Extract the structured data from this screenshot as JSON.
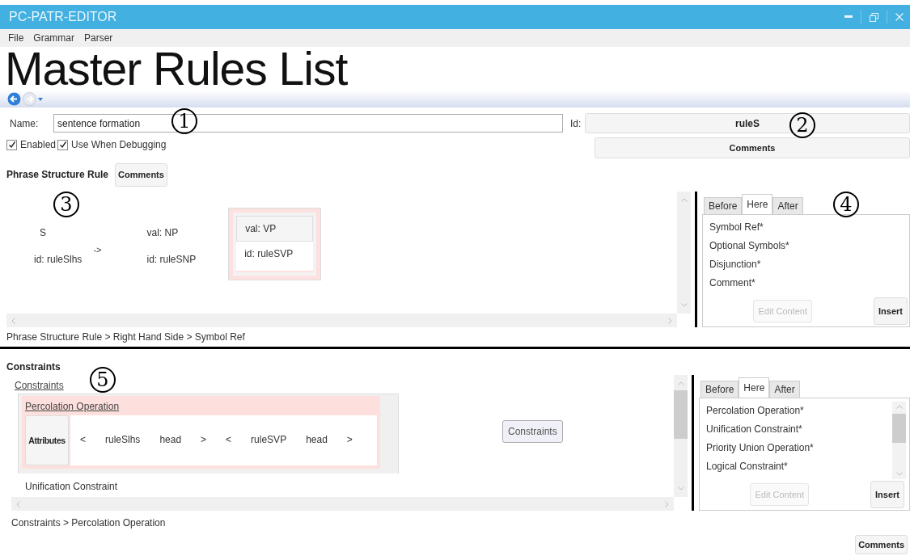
{
  "window": {
    "title": "PC-PATR-EDITOR"
  },
  "menu": [
    "File",
    "Grammar",
    "Parser"
  ],
  "page_title": "Master Rules List",
  "rule": {
    "name_label": "Name:",
    "name": "sentence formation",
    "id_label": "Id:",
    "id": "ruleS",
    "comments_button": "Comments",
    "options": [
      {
        "label": "Enabled",
        "checked": true
      },
      {
        "label": "Use When Debugging",
        "checked": true
      }
    ]
  },
  "phrase_structure": {
    "heading": "Phrase Structure Rule",
    "comments_button": "Comments",
    "lhs": {
      "value": "S",
      "id": "id: ruleSlhs"
    },
    "arrow": "->",
    "rhs": [
      {
        "value": "val: NP",
        "id": "id: ruleSNP",
        "selected": false
      },
      {
        "value": "val: VP",
        "id": "id: ruleSVP",
        "selected": true
      }
    ],
    "breadcrumb": "Phrase Structure Rule > Right Hand Side > Symbol Ref"
  },
  "phrase_palette": {
    "tabs": [
      {
        "label": "Before",
        "selected": false
      },
      {
        "label": "Here",
        "selected": true
      },
      {
        "label": "After",
        "selected": false
      }
    ],
    "items": [
      "Symbol Ref*",
      "Optional Symbols*",
      "Disjunction*",
      "Comment*"
    ],
    "edit_button": {
      "label": "Edit Content",
      "disabled": true
    },
    "insert_button": "Insert"
  },
  "constraints": {
    "heading": "Constraints",
    "link": "Constraints",
    "items": [
      {
        "title": "Percolation Operation",
        "selected": true,
        "attributes_button": "Attributes",
        "tokens": [
          "<",
          "ruleSlhs",
          "head",
          ">",
          "<",
          "ruleSVP",
          "head",
          ">"
        ]
      },
      {
        "title": "Unification Constraint",
        "selected": false
      }
    ],
    "constraints_button": "Constraints",
    "breadcrumb": "Constraints > Percolation Operation"
  },
  "constraint_palette": {
    "tabs": [
      {
        "label": "Before",
        "selected": false
      },
      {
        "label": "Here",
        "selected": true
      },
      {
        "label": "After",
        "selected": false
      }
    ],
    "items": [
      "Percolation Operation*",
      "Unification Constraint*",
      "Priority Union Operation*",
      "Logical Constraint*"
    ],
    "edit_button": {
      "label": "Edit Content",
      "disabled": true
    },
    "insert_button": "Insert"
  },
  "comments_button": "Comments",
  "callouts": [
    "1",
    "2",
    "3",
    "4",
    "5"
  ]
}
